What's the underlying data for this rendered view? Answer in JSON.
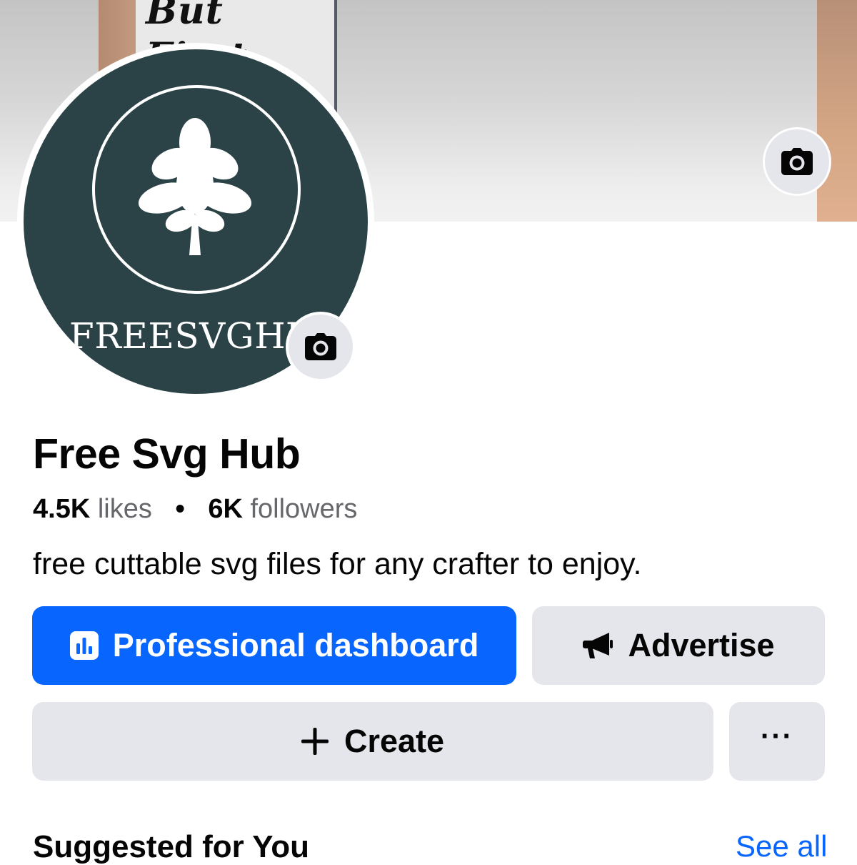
{
  "cover": {
    "sign_text": "But First\nCoffee"
  },
  "avatar": {
    "logo_text": "FREESVGHUB"
  },
  "page": {
    "name": "Free Svg Hub",
    "likes_count": "4.5K",
    "likes_label": "likes",
    "separator": "•",
    "followers_count": "6K",
    "followers_label": "followers",
    "bio": "free cuttable svg files for any crafter to enjoy."
  },
  "actions": {
    "dashboard_label": "Professional dashboard",
    "advertise_label": "Advertise",
    "create_label": "Create",
    "more_label": "···"
  },
  "next_section": {
    "heading": "Suggested for You",
    "see_all": "See all"
  },
  "colors": {
    "primary": "#0866ff",
    "secondary_button": "#e4e6eb",
    "avatar_bg": "#2b4347",
    "muted_text": "#65676b"
  },
  "icons": {
    "cover_camera": "camera-icon",
    "avatar_camera": "camera-icon",
    "dashboard": "bar-chart-icon",
    "advertise": "megaphone-icon",
    "create": "plus-icon",
    "more": "ellipsis-icon"
  }
}
